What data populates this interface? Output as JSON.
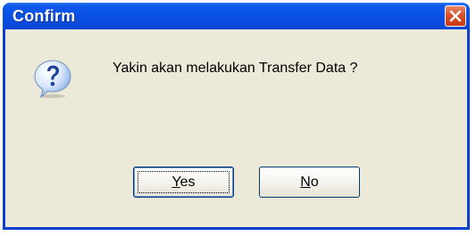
{
  "window": {
    "title": "Confirm",
    "close_icon": "close-icon"
  },
  "dialog": {
    "icon": "question-icon",
    "message": "Yakin akan melakukan Transfer Data ?"
  },
  "buttons": {
    "yes": {
      "mnemonic": "Y",
      "rest": "es"
    },
    "no": {
      "mnemonic": "N",
      "rest": "o"
    }
  },
  "colors": {
    "titlebar": "#0a52e6",
    "client": "#ece9d8",
    "close_button": "#d9502a"
  }
}
